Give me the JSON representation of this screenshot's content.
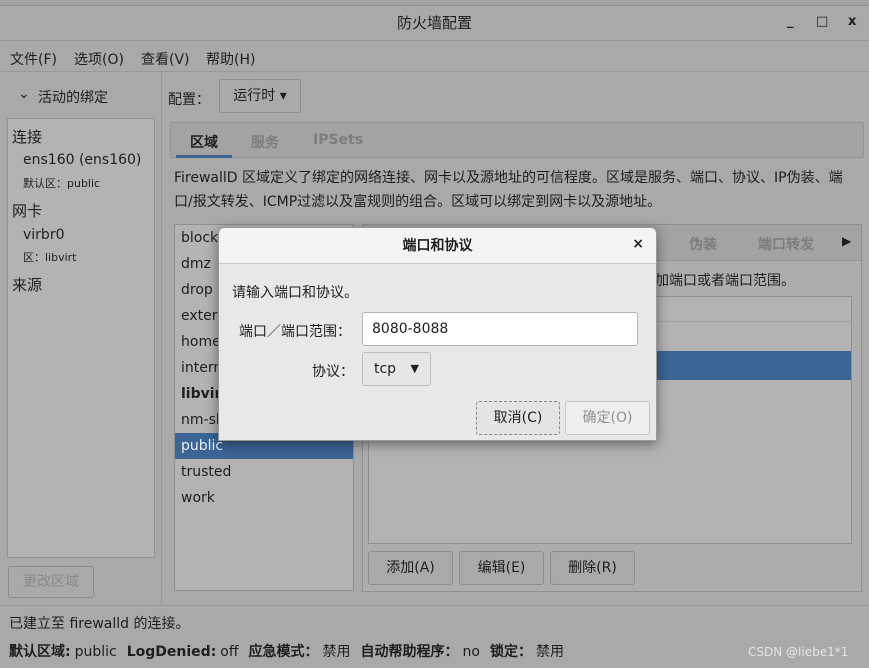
{
  "window": {
    "title": "防火墙配置",
    "minimize": "_",
    "maximize": "□",
    "close": "x"
  },
  "menu": [
    "文件(F)",
    "选项(O)",
    "查看(V)",
    "帮助(H)"
  ],
  "sidebar": {
    "header": "活动的绑定",
    "sections": [
      {
        "title": "连接",
        "name": "ens160 (ens160)",
        "detail": "默认区：public"
      },
      {
        "title": "网卡",
        "name": "virbr0",
        "detail": "区：libvirt"
      },
      {
        "title": "来源"
      }
    ],
    "change_zone": "更改区域"
  },
  "config": {
    "label": "配置：",
    "value": "运行时"
  },
  "tabs": [
    "区域",
    "服务",
    "IPSets"
  ],
  "description": "FirewallD 区域定义了绑定的网络连接、网卡以及源地址的可信程度。区域是服务、端口、协议、IP伪装、端口/报文转发、ICMP过滤以及富规则的组合。区域可以绑定到网卡以及源地址。",
  "zones": [
    "block",
    "dmz",
    "drop",
    "external",
    "home",
    "internal",
    "libvirt",
    "nm-shared",
    "public",
    "trusted",
    "work"
  ],
  "selected_zone": "public",
  "subtabs": [
    "伪装",
    "端口转发"
  ],
  "port_hint": "加端口或者端口范围。",
  "actions": [
    "添加(A)",
    "编辑(E)",
    "删除(R)"
  ],
  "dialog": {
    "title": "端口和协议",
    "close": "×",
    "prompt": "请输入端口和协议。",
    "port_label": "端口／端口范围：",
    "port_value": "8080-8088",
    "proto_label": "协议：",
    "proto_value": "tcp",
    "cancel": "取消(C)",
    "ok": "确定(O)"
  },
  "status": {
    "connection": "已建立至 firewalld 的连接。",
    "items": [
      {
        "k": "默认区域:",
        "v": "public"
      },
      {
        "k": "LogDenied:",
        "v": "off"
      },
      {
        "k": "应急模式：",
        "v": "禁用"
      },
      {
        "k": "自动帮助程序：",
        "v": "no"
      },
      {
        "k": "锁定：",
        "v": "禁用"
      }
    ]
  },
  "watermark": "CSDN @liebe1*1",
  "colors": {
    "selection": "#3a6595",
    "dialog_bg": "#e8e8e8"
  }
}
